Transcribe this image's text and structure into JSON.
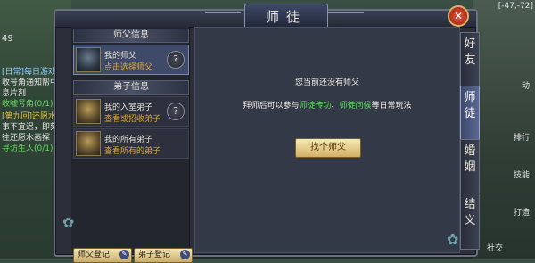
{
  "window": {
    "title": "师徒"
  },
  "background": {
    "level": "49",
    "coords": "[-47,-72]",
    "chat_lines": [
      "[日常]每日游戏",
      "收号角通知帮中",
      "息片刻",
      "收嘘号角(0/1)",
      "[第九回]还愿水",
      "事不宜迟，即刻",
      "往还愿水画探",
      "寻访生人(0/1)"
    ],
    "right_labels": [
      "动",
      "排行",
      "技能",
      "打造",
      "社交"
    ]
  },
  "left_panel": {
    "master_header": "师父信息",
    "master_entry": {
      "title": "我的师父",
      "action": "点击选择师父"
    },
    "disciple_header": "弟子信息",
    "disciple_entries": [
      {
        "title": "我的入室弟子",
        "action": "查看或招收弟子"
      },
      {
        "title": "我的所有弟子",
        "action": "查看所有的弟子"
      }
    ],
    "help_glyph": "?",
    "master_register_btn": "师父登记",
    "disciple_register_btn": "弟子登记"
  },
  "content": {
    "empty_message": "您当前还没有师父",
    "desc_prefix": "拜师后可以参与",
    "desc_highlight1": "师徒传功",
    "desc_sep": "、",
    "desc_highlight2": "师徒问候",
    "desc_suffix": "等日常玩法",
    "find_master_btn": "找个师父"
  },
  "tabs": [
    "好友",
    "师徒",
    "婚姻",
    "结义"
  ],
  "active_tab": "师徒",
  "colors": {
    "highlight": "#58e05a",
    "action": "#e0a531",
    "panel": "#2c2f3a"
  }
}
